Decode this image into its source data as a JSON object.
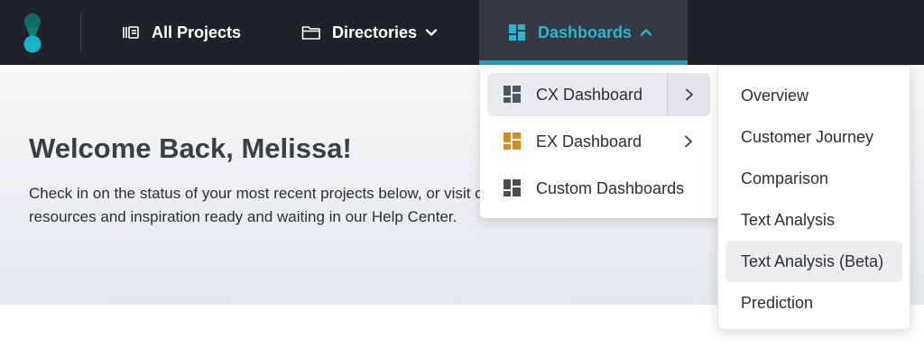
{
  "nav": {
    "all_projects": "All Projects",
    "directories": "Directories",
    "dashboards": "Dashboards"
  },
  "hero": {
    "title": "Welcome Back, Melissa!",
    "text": "Check in on the status of your most recent projects below, or visit our resources and inspiration ready and waiting in our Help Center."
  },
  "dashboards_menu": {
    "items": [
      {
        "label": "CX Dashboard",
        "icon": "grid-icon",
        "icon_color": "#4b5a60",
        "has_submenu": true,
        "active": true
      },
      {
        "label": "EX Dashboard",
        "icon": "grid-icon",
        "icon_color": "#d88a1a",
        "has_submenu": true,
        "active": false
      },
      {
        "label": "Custom Dashboards",
        "icon": "grid-icon",
        "icon_color": "#4a4d52",
        "has_submenu": false,
        "active": false
      }
    ]
  },
  "cx_submenu": {
    "items": [
      {
        "label": "Overview"
      },
      {
        "label": "Customer Journey"
      },
      {
        "label": "Comparison"
      },
      {
        "label": "Text Analysis"
      },
      {
        "label": "Text Analysis (Beta)",
        "hover": true
      },
      {
        "label": "Prediction"
      }
    ]
  },
  "colors": {
    "nav_bg": "#1f2228",
    "nav_active_bg": "#343943",
    "accent": "#29b6d1",
    "logo_top": "#0e6b67",
    "logo_bottom": "#16b3c4"
  }
}
